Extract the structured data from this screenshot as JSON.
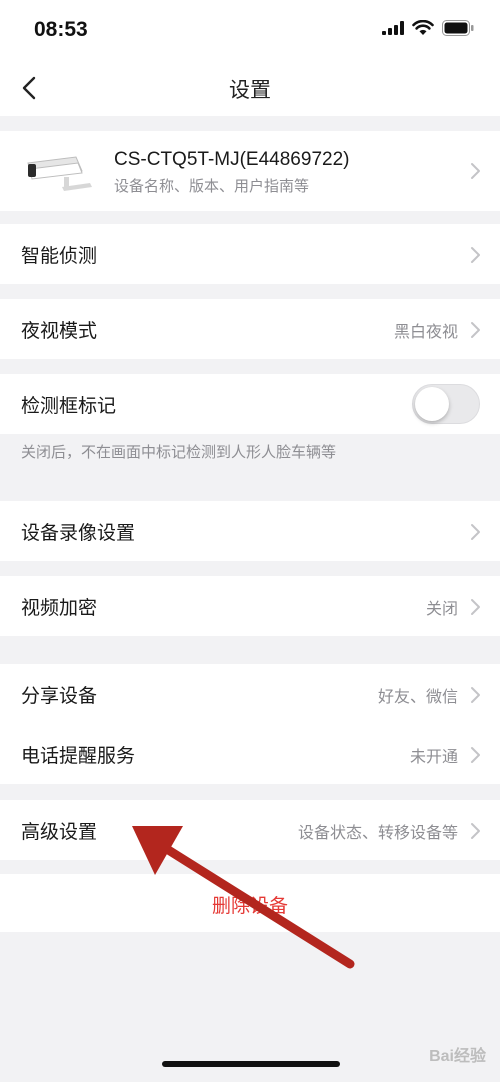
{
  "status_bar": {
    "time": "08:53"
  },
  "nav": {
    "title": "设置"
  },
  "device": {
    "name": "CS-CTQ5T-MJ(E44869722)",
    "subtitle": "设备名称、版本、用户指南等"
  },
  "smart_detect": {
    "label": "智能侦测"
  },
  "night_mode": {
    "label": "夜视模式",
    "value": "黑白夜视"
  },
  "detect_frame": {
    "label": "检测框标记",
    "toggle_on": false,
    "hint": "关闭后，不在画面中标记检测到人形人脸车辆等"
  },
  "recording": {
    "label": "设备录像设置"
  },
  "encryption": {
    "label": "视频加密",
    "value": "关闭"
  },
  "share": {
    "label": "分享设备",
    "value": "好友、微信"
  },
  "phone_alert": {
    "label": "电话提醒服务",
    "value": "未开通"
  },
  "advanced": {
    "label": "高级设置",
    "value": "设备状态、转移设备等"
  },
  "delete": {
    "label": "删除设备"
  },
  "colors": {
    "accent_red": "#e53935",
    "arrow_red": "#b3261e",
    "secondary_text": "#8e8e93"
  },
  "watermark": {
    "text": "Bai经验"
  }
}
